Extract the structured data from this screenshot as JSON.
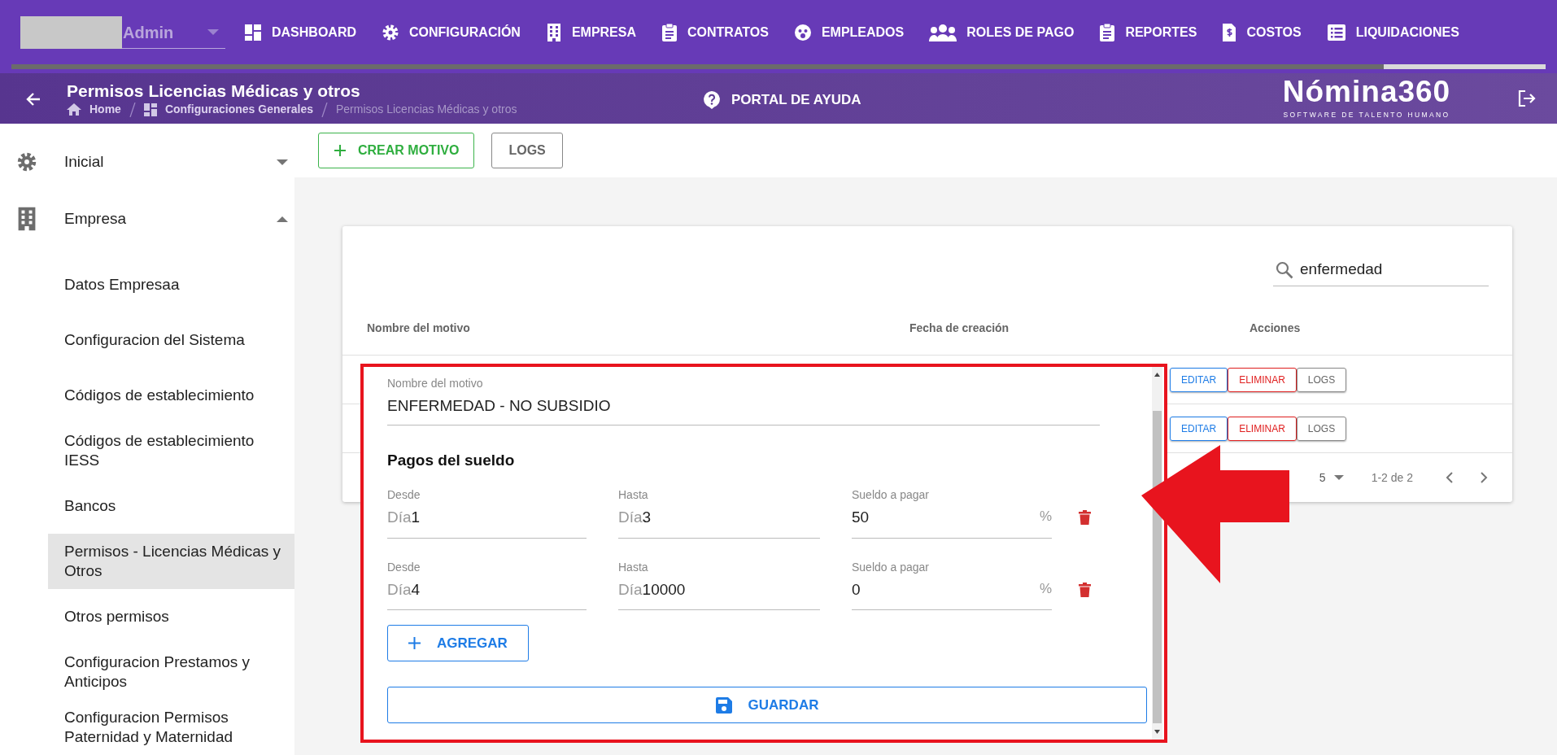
{
  "user_menu": {
    "label": "Admin"
  },
  "nav": [
    {
      "label": "DASHBOARD"
    },
    {
      "label": "CONFIGURACIÓN"
    },
    {
      "label": "EMPRESA"
    },
    {
      "label": "CONTRATOS"
    },
    {
      "label": "EMPLEADOS"
    },
    {
      "label": "ROLES DE PAGO"
    },
    {
      "label": "REPORTES"
    },
    {
      "label": "COSTOS"
    },
    {
      "label": "LIQUIDACIONES"
    }
  ],
  "header": {
    "title": "Permisos Licencias Médicas y otros",
    "breadcrumbs": [
      {
        "label": "Home",
        "current": false
      },
      {
        "label": "Configuraciones Generales",
        "current": false
      },
      {
        "label": "Permisos Licencias Médicas y otros",
        "current": true
      }
    ]
  },
  "help": {
    "label": "PORTAL DE AYUDA"
  },
  "logo": {
    "name": "Nómina360",
    "tagline": "SOFTWARE DE TALENTO HUMANO"
  },
  "toolbar": [
    {
      "label": "CREAR MOTIVO",
      "kind": "create"
    },
    {
      "label": "LOGS",
      "kind": "plain"
    }
  ],
  "sidebar": {
    "items": [
      {
        "label": "Inicial",
        "expanded": false
      },
      {
        "label": "Empresa",
        "expanded": true,
        "children": [
          {
            "label": "Datos Empresaa",
            "selected": false
          },
          {
            "label": "Configuracion del Sistema",
            "selected": false
          },
          {
            "label": "Códigos de establecimiento",
            "selected": false
          },
          {
            "label": "Códigos de establecimiento IESS",
            "selected": false
          },
          {
            "label": "Bancos",
            "selected": false
          },
          {
            "label": "Permisos - Licencias Médicas y Otros",
            "selected": true
          },
          {
            "label": "Otros permisos",
            "selected": false
          },
          {
            "label": "Configuracion Prestamos y Anticipos",
            "selected": false
          },
          {
            "label": "Configuracion Permisos Paternidad y Maternidad",
            "selected": false
          }
        ]
      }
    ]
  },
  "table": {
    "search": {
      "value": "enfermedad"
    },
    "columns": [
      "Nombre del motivo",
      "Fecha de creación",
      "Acciones"
    ],
    "rows": [
      {
        "actions": [
          {
            "label": "EDITAR",
            "kind": "edit"
          },
          {
            "label": "ELIMINAR",
            "kind": "delete"
          },
          {
            "label": "LOGS",
            "kind": "logs"
          }
        ]
      },
      {
        "actions": [
          {
            "label": "EDITAR",
            "kind": "edit"
          },
          {
            "label": "ELIMINAR",
            "kind": "delete"
          },
          {
            "label": "LOGS",
            "kind": "logs"
          }
        ]
      }
    ],
    "pagination": {
      "rows_per_page": "5",
      "range": "1-2 de 2"
    }
  },
  "dialog": {
    "name_field": {
      "label": "Nombre del motivo",
      "value": "ENFERMEDAD - NO SUBSIDIO"
    },
    "section_title": "Pagos del sueldo",
    "payments": [
      {
        "from_label": "Desde",
        "from_prefix": "Día",
        "from": "1",
        "to_label": "Hasta",
        "to_prefix": "Día",
        "to": "3",
        "pay_label": "Sueldo a pagar",
        "pay": "50",
        "pay_suffix": "%"
      },
      {
        "from_label": "Desde",
        "from_prefix": "Día",
        "from": "4",
        "to_label": "Hasta",
        "to_prefix": "Día",
        "to": "10000",
        "pay_label": "Sueldo a pagar",
        "pay": "0",
        "pay_suffix": "%"
      }
    ],
    "add_button": "AGREGAR",
    "save_button": "GUARDAR"
  }
}
